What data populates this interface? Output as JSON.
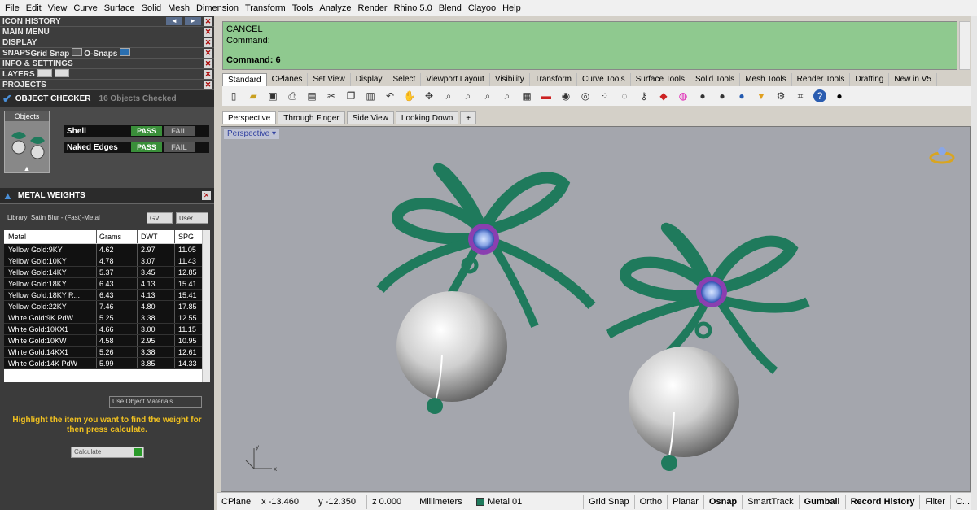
{
  "menu": [
    "File",
    "Edit",
    "View",
    "Curve",
    "Surface",
    "Solid",
    "Mesh",
    "Dimension",
    "Transform",
    "Tools",
    "Analyze",
    "Render",
    "Rhino 5.0",
    "Blend",
    "Clayoo",
    "Help"
  ],
  "panel": {
    "sections": [
      "ICON HISTORY",
      "MAIN MENU",
      "DISPLAY",
      "SNAPS",
      "INFO & SETTINGS",
      "LAYERS",
      "PROJECTS"
    ],
    "grid_snap": "Grid Snap",
    "osnaps": "O-Snaps",
    "object_checker": {
      "title": "OBJECT CHECKER",
      "count": "16 Objects Checked",
      "objects_label": "Objects"
    },
    "checks": [
      {
        "name": "Shell",
        "pass": "PASS",
        "fail": "FAIL"
      },
      {
        "name": "Naked Edges",
        "pass": "PASS",
        "fail": "FAIL"
      }
    ],
    "metal_weights": {
      "title": "METAL WEIGHTS",
      "library": "Library: Satin Blur - (Fast)-Metal",
      "gv": "GV",
      "user": "User",
      "headers": [
        "Metal",
        "Grams",
        "DWT",
        "SPG"
      ],
      "rows": [
        [
          "Yellow Gold:9KY",
          "4.62",
          "2.97",
          "11.05"
        ],
        [
          "Yellow Gold:10KY",
          "4.78",
          "3.07",
          "11.43"
        ],
        [
          "Yellow Gold:14KY",
          "5.37",
          "3.45",
          "12.85"
        ],
        [
          "Yellow Gold:18KY",
          "6.43",
          "4.13",
          "15.41"
        ],
        [
          "Yellow Gold:18KY R...",
          "6.43",
          "4.13",
          "15.41"
        ],
        [
          "Yellow Gold:22KY",
          "7.46",
          "4.80",
          "17.85"
        ],
        [
          "White Gold:9K PdW",
          "5.25",
          "3.38",
          "12.55"
        ],
        [
          "White Gold:10KX1",
          "4.66",
          "3.00",
          "11.15"
        ],
        [
          "White Gold:10KW",
          "4.58",
          "2.95",
          "10.95"
        ],
        [
          "White Gold:14KX1",
          "5.26",
          "3.38",
          "12.61"
        ],
        [
          "White Gold:14K PdW",
          "5.99",
          "3.85",
          "14.33"
        ]
      ],
      "use_obj": "Use Object Materials",
      "hint": "Highlight the item you want to find the weight for then press calculate.",
      "calculate": "Calculate"
    }
  },
  "command": {
    "l1": "CANCEL",
    "l2": "Command:",
    "l3": "Command: 6"
  },
  "tabs": [
    "Standard",
    "CPlanes",
    "Set View",
    "Display",
    "Select",
    "Viewport Layout",
    "Visibility",
    "Transform",
    "Curve Tools",
    "Surface Tools",
    "Solid Tools",
    "Mesh Tools",
    "Render Tools",
    "Drafting",
    "New in V5"
  ],
  "viewtabs": [
    "Perspective",
    "Through Finger",
    "Side View",
    "Looking Down"
  ],
  "viewport_label": "Perspective",
  "status": {
    "cplane": "CPlane",
    "x": "x -13.460",
    "y": "y -12.350",
    "z": "z 0.000",
    "units": "Millimeters",
    "layer": "Metal 01",
    "toggles": [
      "Grid Snap",
      "Ortho",
      "Planar",
      "Osnap",
      "SmartTrack",
      "Gumball",
      "Record History",
      "Filter",
      "C..."
    ]
  },
  "colors": {
    "ribbon": "#1f7a5c",
    "command_bg": "#8fc98f",
    "gem": "#8a3fb0"
  }
}
